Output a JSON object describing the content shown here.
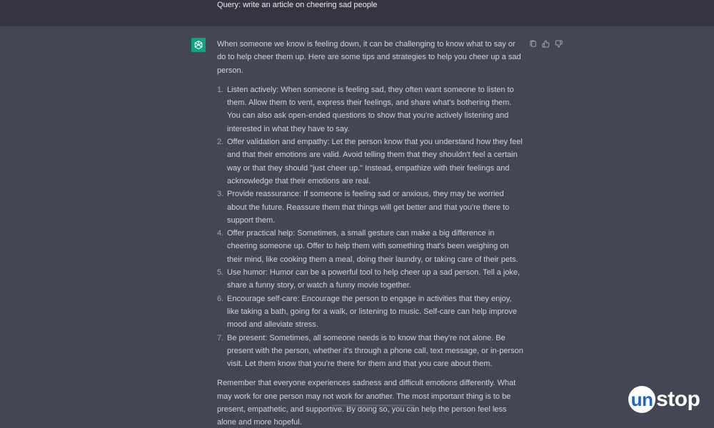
{
  "query": {
    "text": "Query: write an article on cheering sad people"
  },
  "response": {
    "intro": "When someone we know is feeling down, it can be challenging to know what to say or do to help cheer them up. Here are some tips and strategies to help you cheer up a sad person.",
    "items": [
      {
        "num": "1.",
        "text": "Listen actively: When someone is feeling sad, they often want someone to listen to them. Allow them to vent, express their feelings, and share what's bothering them. You can also ask open-ended questions to show that you're actively listening and interested in what they have to say."
      },
      {
        "num": "2.",
        "text": "Offer validation and empathy: Let the person know that you understand how they feel and that their emotions are valid. Avoid telling them that they shouldn't feel a certain way or that they should \"just cheer up.\" Instead, empathize with their feelings and acknowledge that their emotions are real."
      },
      {
        "num": "3.",
        "text": "Provide reassurance: If someone is feeling sad or anxious, they may be worried about the future. Reassure them that things will get better and that you're there to support them."
      },
      {
        "num": "4.",
        "text": "Offer practical help: Sometimes, a small gesture can make a big difference in cheering someone up. Offer to help them with something that's been weighing on their mind, like cooking them a meal, doing their laundry, or taking care of their pets."
      },
      {
        "num": "5.",
        "text": "Use humor: Humor can be a powerful tool to help cheer up a sad person. Tell a joke, share a funny story, or watch a funny movie together."
      },
      {
        "num": "6.",
        "text": "Encourage self-care: Encourage the person to engage in activities that they enjoy, like taking a bath, going for a walk, or listening to music. Self-care can help improve mood and alleviate stress."
      },
      {
        "num": "7.",
        "text": "Be present: Sometimes, all someone needs is to know that they're not alone. Be present with the person, whether it's through a phone call, text message, or in-person visit. Let them know that you're there for them and that you care about them."
      }
    ],
    "closing": "Remember that everyone experiences sadness and difficult emotions differently. What may work for one person may not work for another. The most important thing is to be present, empathetic, and supportive. By doing so, you can help the person feel less alone and more hopeful."
  },
  "actions": {
    "icons": [
      "copy-icon",
      "thumbs-up-icon",
      "thumbs-down-icon"
    ]
  },
  "brand": {
    "circle_text": "un",
    "rest_text": "stop",
    "accent": "#1f64c7"
  },
  "colors": {
    "response_bg": "#444654",
    "user_bg": "#343541",
    "avatar": "#10a37f"
  }
}
